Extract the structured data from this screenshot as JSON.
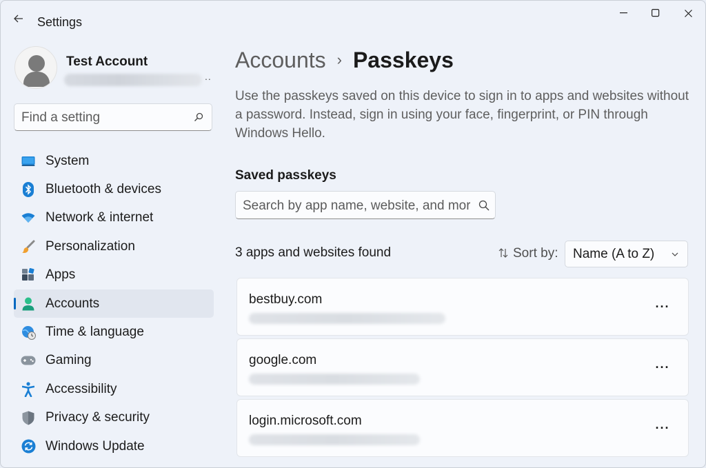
{
  "window": {
    "title": "Settings",
    "controls": {
      "minimize": "—",
      "maximize": "☐",
      "close": "✕"
    }
  },
  "profile": {
    "name": "Test Account",
    "more": ".."
  },
  "sidebar": {
    "search_placeholder": "Find a setting",
    "items": [
      {
        "label": "System",
        "icon": "monitor-icon"
      },
      {
        "label": "Bluetooth & devices",
        "icon": "bluetooth-icon"
      },
      {
        "label": "Network & internet",
        "icon": "wifi-icon"
      },
      {
        "label": "Personalization",
        "icon": "paintbrush-icon"
      },
      {
        "label": "Apps",
        "icon": "apps-icon"
      },
      {
        "label": "Accounts",
        "icon": "person-icon",
        "selected": true
      },
      {
        "label": "Time & language",
        "icon": "globe-clock-icon"
      },
      {
        "label": "Gaming",
        "icon": "gamepad-icon"
      },
      {
        "label": "Accessibility",
        "icon": "accessibility-icon"
      },
      {
        "label": "Privacy & security",
        "icon": "shield-icon"
      },
      {
        "label": "Windows Update",
        "icon": "update-icon"
      }
    ]
  },
  "main": {
    "breadcrumb": {
      "parent": "Accounts",
      "separator": "›",
      "current": "Passkeys"
    },
    "description": "Use the passkeys saved on this device to sign in to apps and websites without a password. Instead, sign in using your face, fingerprint, or PIN through Windows Hello.",
    "section_title": "Saved passkeys",
    "search_placeholder": "Search by app name, website, and more",
    "found_text": "3 apps and websites found",
    "sort": {
      "label": "Sort by:",
      "value": "Name (A to Z)"
    },
    "passkeys": [
      {
        "site": "bestbuy.com",
        "more": "···"
      },
      {
        "site": "google.com",
        "more": "···"
      },
      {
        "site": "login.microsoft.com",
        "more": "···"
      }
    ]
  },
  "colors": {
    "accent": "#0067c0",
    "window_bg": "#eef2f9",
    "card_bg": "#fbfcfe"
  }
}
